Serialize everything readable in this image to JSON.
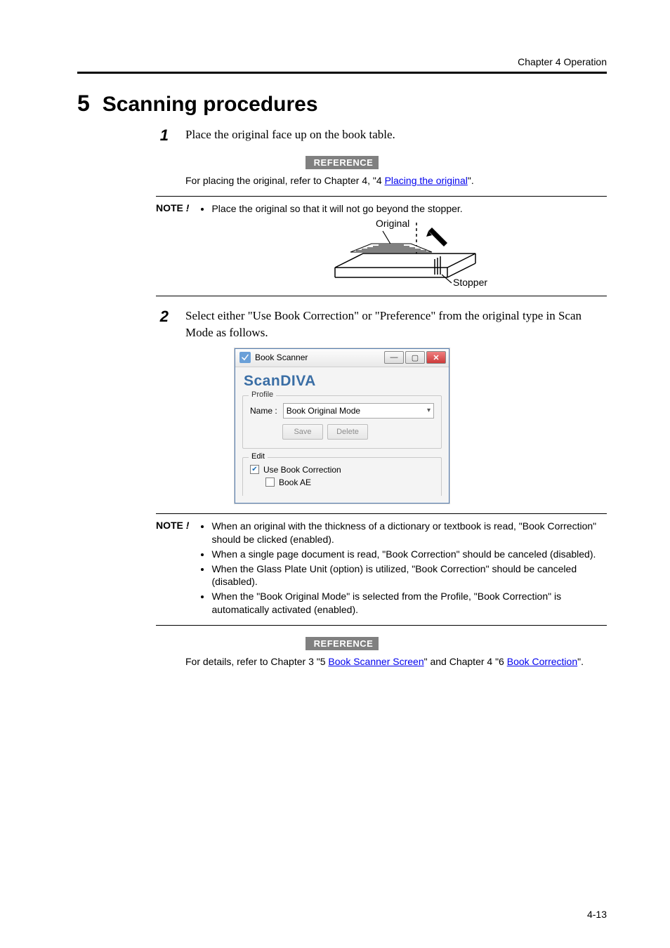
{
  "header": {
    "chapter_label": "Chapter 4 Operation"
  },
  "section": {
    "number": "5",
    "title": "Scanning procedures"
  },
  "steps": {
    "s1": {
      "num": "1",
      "text": "Place the original face up on the book table."
    },
    "s2": {
      "num": "2",
      "text": "Select either \"Use Book Correction\" or \"Preference\" from the original type in Scan Mode as follows."
    }
  },
  "reference_badge": "REFERENCE",
  "ref1": {
    "pre": "For placing the original, refer to Chapter 4, \"4 ",
    "link": "Placing the original",
    "post": "\"."
  },
  "note_label": "NOTE",
  "note_bang": "!",
  "note1": {
    "item1": "Place the original so that it will not go beyond the stopper."
  },
  "diagram": {
    "original_label": "Original",
    "stopper_label": "Stopper"
  },
  "bs_window": {
    "title": "Book Scanner",
    "brand": "ScanDIVA",
    "profile_legend": "Profile",
    "name_label": "Name :",
    "combo_value": "Book Original Mode",
    "save_btn": "Save",
    "delete_btn": "Delete",
    "edit_legend": "Edit",
    "use_book_correction": "Use Book Correction",
    "book_ae": "Book AE",
    "min_glyph": "—",
    "max_glyph": "▢",
    "close_glyph": "✕",
    "caret": "▾"
  },
  "note2": {
    "item1": "When an original with the thickness of a dictionary or textbook is read, \"Book Correction\" should be clicked (enabled).",
    "item2": "When a single page document is read, \"Book Correction\" should be canceled (disabled).",
    "item3": "When the Glass Plate Unit (option) is utilized, \"Book Correction\" should be canceled (disabled).",
    "item4": "When the \"Book Original Mode\" is selected from the Profile, \"Book Correction\" is automatically activated (enabled)."
  },
  "ref2": {
    "pre": "For details, refer to Chapter 3 \"5 ",
    "link1": "Book Scanner Screen",
    "mid": "\" and Chapter 4 \"6 ",
    "link2": "Book Correction",
    "post": "\"."
  },
  "page_number": "4-13"
}
